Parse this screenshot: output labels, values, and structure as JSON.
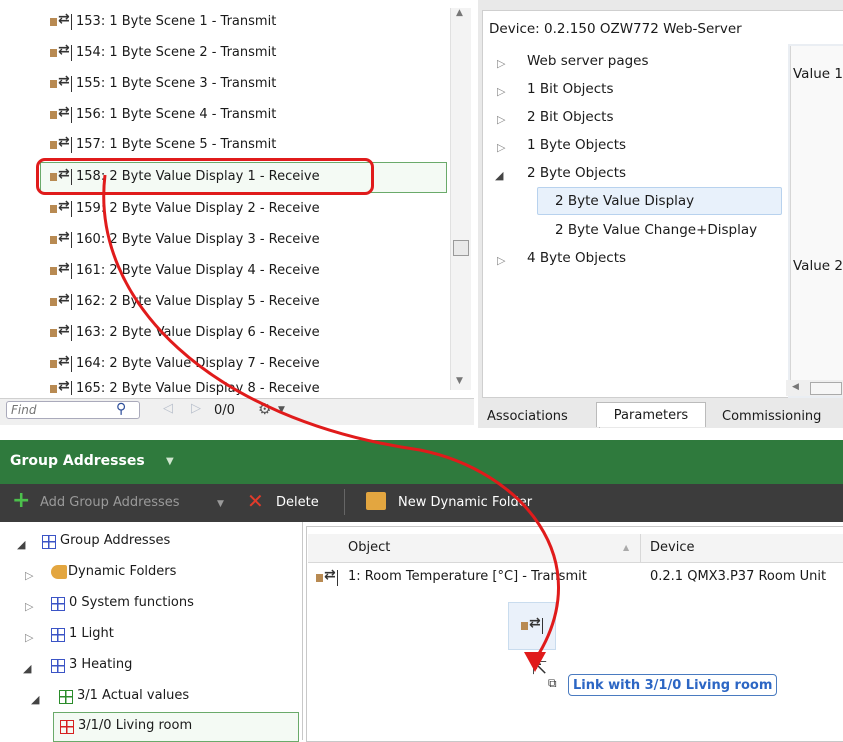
{
  "object_list": {
    "rows": [
      "153: 1 Byte Scene 1 - Transmit",
      "154: 1 Byte Scene 2 - Transmit",
      "155: 1 Byte Scene 3 - Transmit",
      "156: 1 Byte Scene 4 - Transmit",
      "157: 1 Byte Scene 5 - Transmit",
      "158: 2 Byte Value Display 1 - Receive",
      "159: 2 Byte Value Display 2 - Receive",
      "160: 2 Byte Value Display 3 - Receive",
      "161: 2 Byte Value Display 4 - Receive",
      "162: 2 Byte Value Display 5 - Receive",
      "163: 2 Byte Value Display 6 - Receive",
      "164: 2 Byte Value Display 7 - Receive",
      "165: 2 Byte Value Display 8 - Receive"
    ],
    "selected_index": 5,
    "find": {
      "placeholder": "Find",
      "count": "0/0"
    }
  },
  "device_panel": {
    "title": "Device: 0.2.150  OZW772 Web-Server",
    "tree": [
      "Web server pages",
      "1 Bit Objects",
      "2 Bit Objects",
      "1 Byte Objects",
      "2 Byte Objects",
      "2 Byte Value Display",
      "2 Byte Value Change+Display",
      "4 Byte Objects"
    ],
    "side_labels": [
      "Value 1",
      "Value 2"
    ],
    "tabs": [
      "Associations",
      "Parameters",
      "Commissioning"
    ],
    "active_tab": "Parameters"
  },
  "group_addresses": {
    "header_title": "Group Addresses",
    "toolbar": {
      "add_label": "Add Group Addresses",
      "delete_label": "Delete",
      "new_folder_label": "New Dynamic Folder"
    },
    "tree": [
      "Group Addresses",
      "Dynamic Folders",
      "0 System functions",
      "1 Light",
      "3 Heating",
      "3/1 Actual values",
      "3/1/0 Living room"
    ],
    "table": {
      "columns": [
        "Object",
        "Device"
      ],
      "rows": [
        {
          "object": "1: Room Temperature [°C] - Transmit",
          "device": "0.2.1  QMX3.P37 Room Unit"
        }
      ]
    },
    "drag_tooltip": "Link with 3/1/0 Living room"
  },
  "colors": {
    "header_green": "#2f7a3d",
    "toolbar_dark": "#3c3c3c",
    "highlight_red": "#e01b1b",
    "tooltip_blue": "#2c66c4"
  }
}
